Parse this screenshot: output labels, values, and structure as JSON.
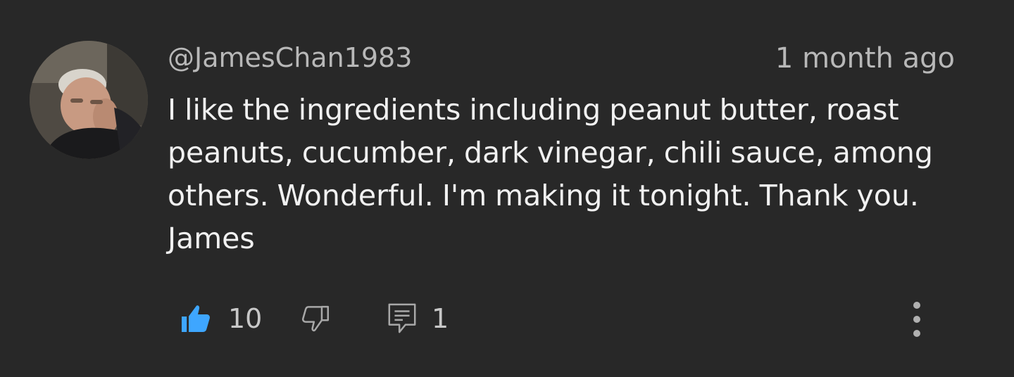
{
  "comment": {
    "author": "@JamesChan1983",
    "timestamp": "1 month ago",
    "body_lines": [
      "I like the ingredients including peanut butter, roast",
      "peanuts, cucumber, dark vinegar, chili sauce, among",
      "others. Wonderful. I'm making it tonight. Thank you.",
      "James"
    ],
    "like_count": "10",
    "reply_count": "1",
    "liked": true
  },
  "icons": {
    "like": "thumbs-up-icon",
    "dislike": "thumbs-down-icon",
    "reply": "comment-icon",
    "more": "more-vertical-icon"
  },
  "colors": {
    "background": "#282828",
    "like_active": "#3ea6ff",
    "secondary_text": "#b8b8b8",
    "icon": "#a8a8a8"
  }
}
